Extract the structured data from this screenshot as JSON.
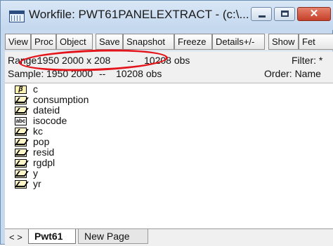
{
  "window": {
    "title": "Workfile: PWT61PANELEXTRACT - (c:\\...",
    "min_label": "–",
    "max_label": "□",
    "close_label": "✕"
  },
  "toolbar": {
    "buttons": [
      "View",
      "Proc",
      "Object",
      "Save",
      "Snapshot",
      "Freeze",
      "Details+/-",
      "Show",
      "Fet"
    ]
  },
  "info": {
    "range_label": "Range:",
    "range_value": "1950 2000 x 208",
    "range_sep": "--",
    "range_obs": "10208 obs",
    "filter": "Filter: *",
    "sample_label": "Sample:",
    "sample_value": "1950 2000",
    "sample_sep": "--",
    "sample_obs": "10208 obs",
    "order": "Order: Name"
  },
  "objects": [
    {
      "name": "c",
      "icon": "coefficient-icon"
    },
    {
      "name": "consumption",
      "icon": "series-icon"
    },
    {
      "name": "dateid",
      "icon": "series-icon"
    },
    {
      "name": "isocode",
      "icon": "alpha-icon"
    },
    {
      "name": "kc",
      "icon": "series-icon"
    },
    {
      "name": "pop",
      "icon": "series-icon"
    },
    {
      "name": "resid",
      "icon": "series-icon"
    },
    {
      "name": "rgdpl",
      "icon": "series-icon"
    },
    {
      "name": "y",
      "icon": "series-icon"
    },
    {
      "name": "yr",
      "icon": "series-icon"
    }
  ],
  "tabs": {
    "nav": "< >",
    "items": [
      "Pwt61",
      "New Page"
    ]
  },
  "colors": {
    "highlight": "#e4141b",
    "titlebar": "#c7d9ee"
  }
}
